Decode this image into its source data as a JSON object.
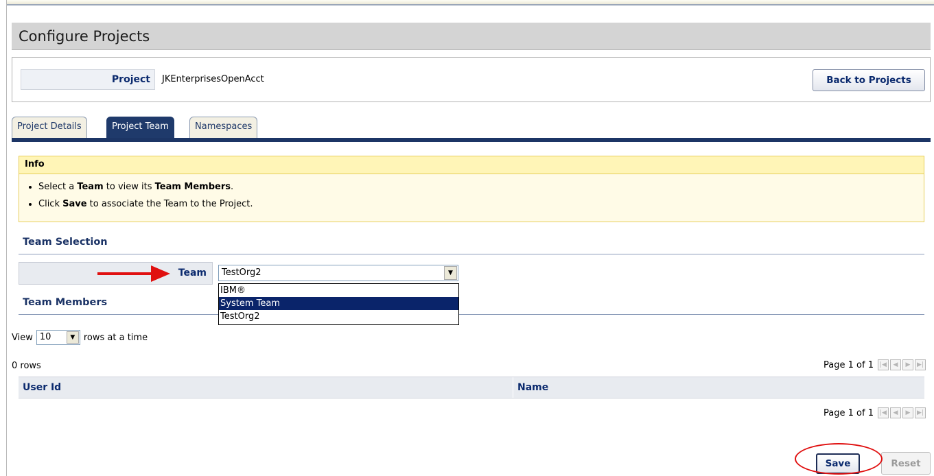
{
  "page": {
    "title": "Configure Projects"
  },
  "project": {
    "label": "Project",
    "value": "JKEnterprisesOpenAcct",
    "back_button": "Back to Projects"
  },
  "tabs": [
    {
      "label": "Project Details",
      "active": false
    },
    {
      "label": "Project Team",
      "active": true
    },
    {
      "label": "Namespaces",
      "active": false
    }
  ],
  "info": {
    "heading": "Info",
    "items": [
      {
        "p1": "Select a ",
        "b1": "Team",
        "p2": " to view its ",
        "b2": "Team Members",
        "p3": "."
      },
      {
        "p1": "Click ",
        "b1": "Save",
        "p2": " to associate the Team to the Project."
      }
    ]
  },
  "team_selection": {
    "heading": "Team Selection",
    "label": "Team",
    "selected": "TestOrg2",
    "options": [
      "IBM®",
      "System Team",
      "TestOrg2"
    ],
    "highlighted_option": "System Team"
  },
  "team_members": {
    "heading": "Team Members",
    "view_prefix": "View",
    "rows_per_page": "10",
    "view_suffix": "rows at a time",
    "rows_count": "0 rows",
    "pager_text": "Page 1 of 1",
    "columns": [
      "User Id",
      "Name"
    ]
  },
  "actions": {
    "save": "Save",
    "reset": "Reset"
  },
  "colors": {
    "accent": "#1f3a6b",
    "highlight_annotation": "#e01010",
    "info_bg": "#fffbe7"
  },
  "icons": [
    "dropdown-arrow-icon",
    "first-page-icon",
    "previous-page-icon",
    "next-page-icon",
    "last-page-icon"
  ]
}
